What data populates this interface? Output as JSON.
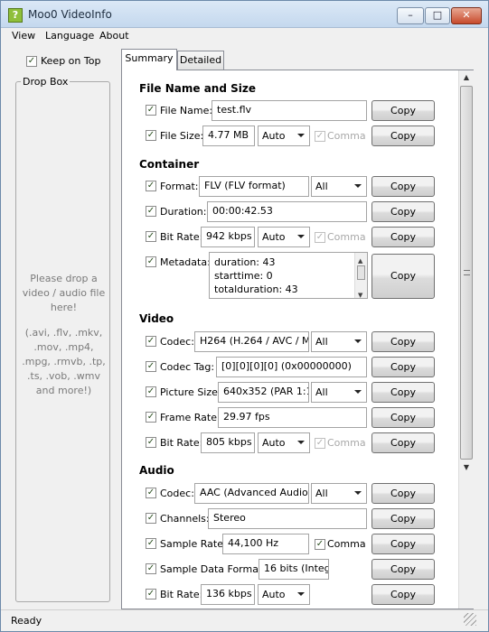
{
  "window": {
    "title": "Moo0 VideoInfo",
    "min": "–",
    "max": "□",
    "close": "✕"
  },
  "menu": [
    "View",
    "Language",
    "About"
  ],
  "keep_on_top": {
    "label": "Keep on Top",
    "checked": true
  },
  "drop_box": {
    "title": "Drop Box",
    "hint": "Please drop a video / audio file here!",
    "extensions": "(.avi, .flv, .mkv, .mov, .mp4, .mpg, .rmvb, .tp, .ts, .vob, .wmv and more!)"
  },
  "tabs": [
    {
      "label": "Summary",
      "active": true
    },
    {
      "label": "Detailed",
      "active": false
    }
  ],
  "copy_label": "Copy",
  "comma_label": "Comma",
  "sections": {
    "file": "File Name and Size",
    "container": "Container",
    "video": "Video",
    "audio": "Audio"
  },
  "fields": {
    "file_name": {
      "label": "File Name:",
      "value": "test.flv"
    },
    "file_size": {
      "label": "File Size:",
      "value": "4.77 MB",
      "unit": "Auto"
    },
    "format": {
      "label": "Format:",
      "value": "FLV  (FLV format)",
      "option": "All"
    },
    "duration": {
      "label": "Duration:",
      "value": "00:00:42.53"
    },
    "container_bitrate": {
      "label": "Bit Rate:",
      "value": "942 kbps",
      "unit": "Auto"
    },
    "metadata": {
      "label": "Metadata:",
      "lines": [
        "duration: 43",
        "starttime: 0",
        "totalduration: 43"
      ]
    },
    "video_codec": {
      "label": "Codec:",
      "value": "H264  (H.264 / AVC / M",
      "option": "All"
    },
    "codec_tag": {
      "label": "Codec Tag:",
      "value": "[0][0][0][0] (0x00000000)"
    },
    "picture_size": {
      "label": "Picture Size:",
      "value": "640x352  (PAR 1:1,",
      "option": "All"
    },
    "frame_rate": {
      "label": "Frame Rate:",
      "value": "29.97 fps"
    },
    "video_bitrate": {
      "label": "Bit Rate:",
      "value": "805 kbps",
      "unit": "Auto"
    },
    "audio_codec": {
      "label": "Codec:",
      "value": "AAC  (Advanced Audio",
      "option": "All"
    },
    "channels": {
      "label": "Channels:",
      "value": "Stereo"
    },
    "sample_rate": {
      "label": "Sample Rate:",
      "value": "44,100 Hz"
    },
    "sample_format": {
      "label": "Sample Data Format:",
      "value": "16 bits (Integ"
    },
    "audio_bitrate": {
      "label": "Bit Rate:",
      "value": "136 kbps",
      "unit": "Auto"
    }
  },
  "status": "Ready",
  "check_mark": "✓"
}
